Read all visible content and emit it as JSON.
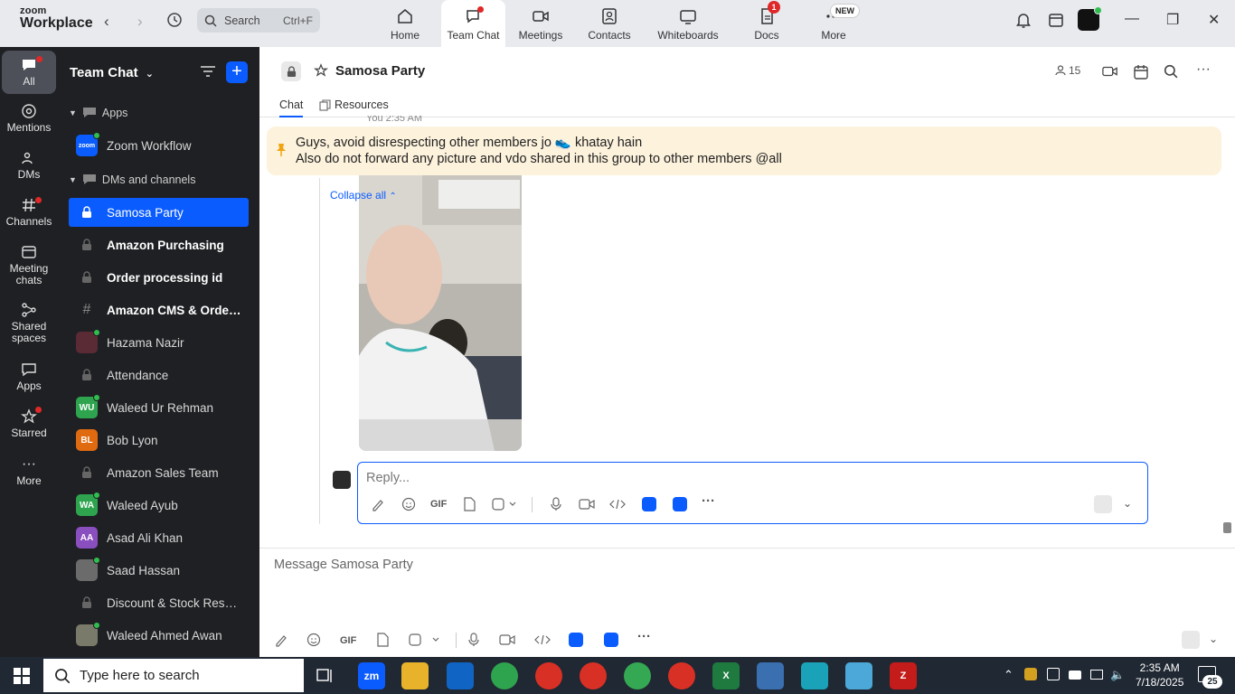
{
  "app": {
    "logo_top": "zoom",
    "logo_bottom": "Workplace",
    "search_placeholder": "Search",
    "search_shortcut": "Ctrl+F"
  },
  "top_tabs": [
    {
      "label": "Home"
    },
    {
      "label": "Team Chat"
    },
    {
      "label": "Meetings"
    },
    {
      "label": "Contacts"
    },
    {
      "label": "Whiteboards"
    },
    {
      "label": "Docs",
      "badge": "1"
    },
    {
      "label": "More",
      "badge": "NEW"
    }
  ],
  "rail": [
    {
      "label": "All"
    },
    {
      "label": "Mentions"
    },
    {
      "label": "DMs"
    },
    {
      "label": "Channels"
    },
    {
      "label": "Meeting chats"
    },
    {
      "label": "Shared spaces"
    },
    {
      "label": "Apps"
    },
    {
      "label": "Starred"
    },
    {
      "label": "More"
    }
  ],
  "panel": {
    "title": "Team Chat",
    "section_apps": "Apps",
    "zoom_workflow": "Zoom Workflow",
    "zoom_workflow_icon_text": "zoom",
    "section_dms": "DMs and channels",
    "items": [
      {
        "label": "Samosa Party"
      },
      {
        "label": "Amazon Purchasing"
      },
      {
        "label": "Order processing id"
      },
      {
        "label": "Amazon CMS & Order..."
      },
      {
        "label": "Hazama Nazir"
      },
      {
        "label": "Attendance"
      },
      {
        "label": "Waleed Ur Rehman",
        "initials": "WU"
      },
      {
        "label": "Bob Lyon",
        "initials": "BL"
      },
      {
        "label": "Amazon Sales Team"
      },
      {
        "label": "Waleed Ayub",
        "initials": "WA"
      },
      {
        "label": "Asad Ali Khan",
        "initials": "AA"
      },
      {
        "label": "Saad Hassan"
      },
      {
        "label": "Discount & Stock Reser..."
      },
      {
        "label": "Waleed Ahmed Awan"
      }
    ]
  },
  "channel": {
    "title": "Samosa Party",
    "member_count": "15",
    "tab_chat": "Chat",
    "tab_resources": "Resources",
    "partial_timestamp": "You 2:35 AM",
    "pinned_line1": "Guys, avoid disrespecting other members jo 👟 khatay hain",
    "pinned_line2": "Also do not forward any picture and vdo shared in this group to other members @all",
    "collapse_label": "Collapse all",
    "reply_placeholder": "Reply...",
    "composer_placeholder": "Message Samosa Party",
    "gif_label": "GIF"
  },
  "taskbar": {
    "search_placeholder": "Type here to search",
    "time": "2:35 AM",
    "date": "7/18/2025",
    "notifications": "25"
  }
}
